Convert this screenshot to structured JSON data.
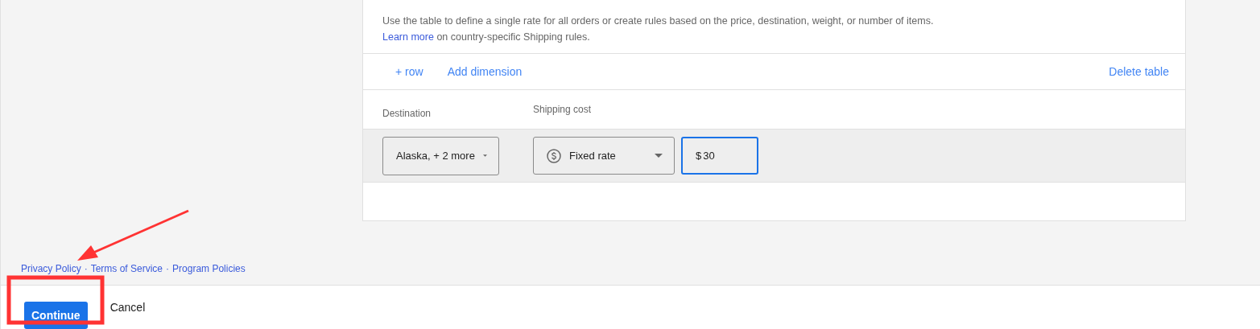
{
  "description": {
    "text": "Use the table to define a single rate for all orders or create rules based on the price, destination, weight, or number of items.",
    "link": "Learn more",
    "link_suffix": " on country-specific Shipping rules."
  },
  "toolbar": {
    "actions": [
      "+ row",
      "Add dimension"
    ],
    "delete": "Delete table"
  },
  "table": {
    "columns": [
      "Destination",
      "Shipping cost"
    ],
    "rows": [
      {
        "destination": "Alaska, + 2 more",
        "rate_type": "Fixed rate",
        "currency": "$",
        "value": "30",
        "focused": true
      }
    ]
  },
  "footer_links": {
    "items": [
      "Privacy Policy",
      "Terms of Service",
      "Program Policies"
    ],
    "separator": "·"
  },
  "bottom_bar": {
    "primary": "Continue",
    "secondary": "Cancel"
  },
  "annotation": {
    "arrow": true,
    "highlight": true
  }
}
